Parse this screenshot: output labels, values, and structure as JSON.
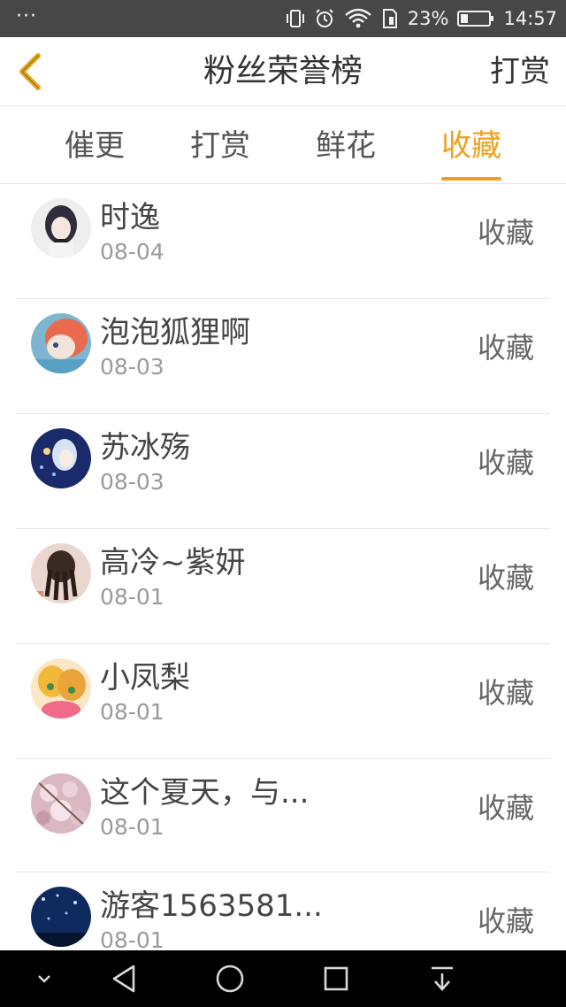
{
  "status_bar": {
    "more": "···",
    "battery_percent": "23%",
    "time": "14:57"
  },
  "header": {
    "title": "粉丝荣誉榜",
    "action": "打赏"
  },
  "tabs": [
    {
      "label": "催更",
      "active": false
    },
    {
      "label": "打赏",
      "active": false
    },
    {
      "label": "鲜花",
      "active": false
    },
    {
      "label": "收藏",
      "active": true
    }
  ],
  "accent_color": "#f0a01e",
  "fans": [
    {
      "name": "时逸",
      "date": "08-04",
      "kind": "收藏"
    },
    {
      "name": "泡泡狐狸啊",
      "date": "08-03",
      "kind": "收藏"
    },
    {
      "name": "苏冰殇",
      "date": "08-03",
      "kind": "收藏"
    },
    {
      "name": "高冷~紫妍",
      "date": "08-01",
      "kind": "收藏"
    },
    {
      "name": "小凤梨",
      "date": "08-01",
      "kind": "收藏"
    },
    {
      "name": "这个夏天，与...",
      "date": "08-01",
      "kind": "收藏"
    },
    {
      "name": "游客1563581...",
      "date": "08-01",
      "kind": "收藏"
    }
  ]
}
